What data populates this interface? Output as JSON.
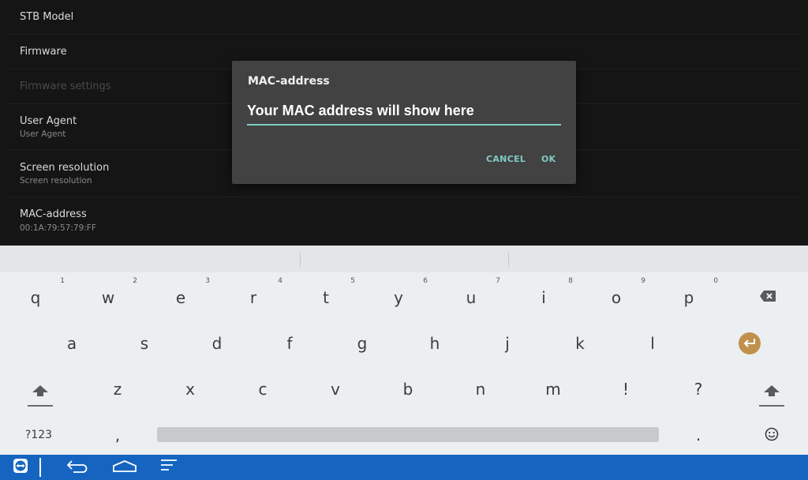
{
  "settings": {
    "items": [
      {
        "title": "STB Model",
        "subtitle": ""
      },
      {
        "title": "Firmware",
        "subtitle": ""
      },
      {
        "title": "Firmware settings",
        "subtitle": ""
      },
      {
        "title": "User Agent",
        "subtitle": "User Agent"
      },
      {
        "title": "Screen resolution",
        "subtitle": "Screen resolution"
      },
      {
        "title": "MAC-address",
        "subtitle": "00:1A:79:57:79:FF"
      }
    ]
  },
  "dialog": {
    "title": "MAC-address",
    "input_value": "Your MAC address will show here",
    "cancel_label": "CANCEL",
    "ok_label": "OK"
  },
  "keyboard": {
    "row1": [
      {
        "char": "q",
        "hint": "1"
      },
      {
        "char": "w",
        "hint": "2"
      },
      {
        "char": "e",
        "hint": "3"
      },
      {
        "char": "r",
        "hint": "4"
      },
      {
        "char": "t",
        "hint": "5"
      },
      {
        "char": "y",
        "hint": "6"
      },
      {
        "char": "u",
        "hint": "7"
      },
      {
        "char": "i",
        "hint": "8"
      },
      {
        "char": "o",
        "hint": "9"
      },
      {
        "char": "p",
        "hint": "0"
      }
    ],
    "row2": [
      "a",
      "s",
      "d",
      "f",
      "g",
      "h",
      "j",
      "k",
      "l"
    ],
    "row3": [
      "z",
      "x",
      "c",
      "v",
      "b",
      "n",
      "m",
      "!",
      "?"
    ],
    "symbols_label": "?123",
    "comma_label": ",",
    "period_label": ".",
    "icons": {
      "backspace": "backspace-icon",
      "enter": "enter-icon",
      "shift": "shift-icon",
      "emoji": "emoji-icon"
    },
    "enter_color": "#c0914c"
  },
  "navbar": {
    "color": "#1565c0",
    "icons": [
      "teamviewer-icon",
      "back-icon",
      "home-icon",
      "menu-icon"
    ]
  }
}
